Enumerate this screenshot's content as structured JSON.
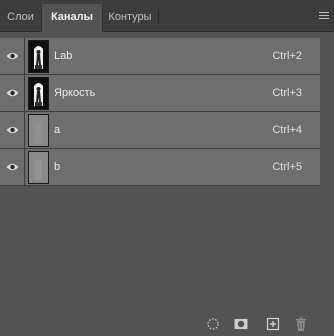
{
  "tabs": [
    {
      "label": "Слои",
      "active": false
    },
    {
      "label": "Каналы",
      "active": true
    },
    {
      "label": "Контуры",
      "active": false
    }
  ],
  "channels": [
    {
      "name": "Lab",
      "shortcut": "Ctrl+2",
      "visible": true,
      "thumbnail": "dark-figure"
    },
    {
      "name": "Яркость",
      "shortcut": "Ctrl+3",
      "visible": true,
      "thumbnail": "dark-figure"
    },
    {
      "name": "a",
      "shortcut": "Ctrl+4",
      "visible": true,
      "thumbnail": "gray"
    },
    {
      "name": "b",
      "shortcut": "Ctrl+5",
      "visible": true,
      "thumbnail": "gray"
    }
  ],
  "colors": {
    "panel_bg": "#535353",
    "tabbar_bg": "#3c3c3c",
    "row_selected": "#6e6e6e"
  },
  "icons": {
    "panel_menu": "hamburger-menu-icon",
    "visibility": "eye-icon",
    "load_selection": "dotted-circle-selection-icon",
    "save_selection": "mask-icon",
    "new_channel": "new-channel-icon",
    "delete": "trash-icon"
  }
}
